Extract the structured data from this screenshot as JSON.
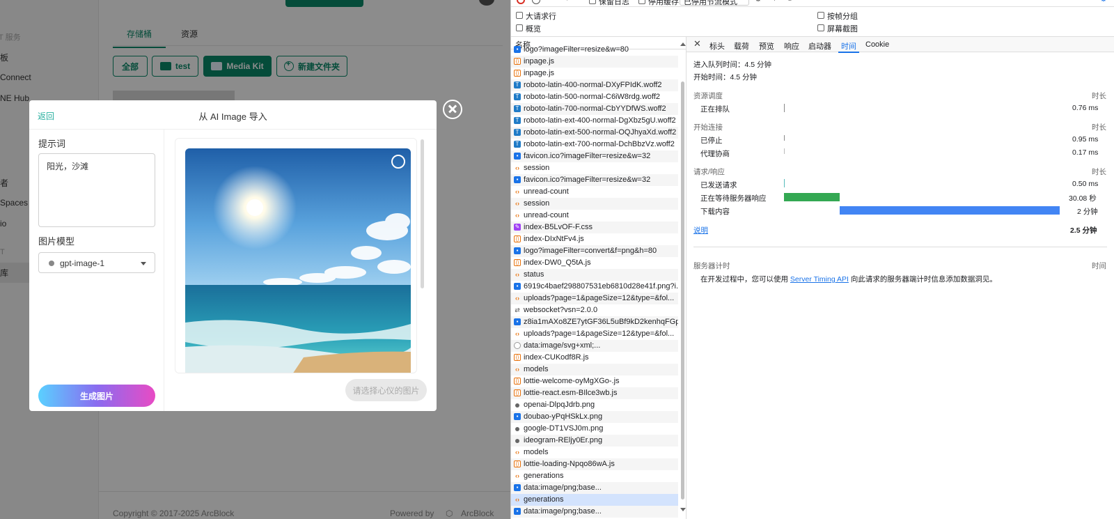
{
  "app": {
    "sidebar_items": [
      "T 服务",
      "板",
      "Connect",
      "NE Hub",
      "者",
      "Spaces",
      "io",
      "T",
      "库"
    ],
    "tabs": [
      "存储桶",
      "资源"
    ],
    "buttons": [
      "全部",
      "test",
      "Media Kit",
      "新建文件夹"
    ],
    "footer_copyright": "Copyright © 2017-2025  ArcBlock",
    "footer_powered": "Powered by",
    "footer_brand": "ArcBlock"
  },
  "modal": {
    "back": "返回",
    "title": "从 AI Image 导入",
    "prompt_label": "提示词",
    "prompt_value": "阳光，沙滩",
    "model_label": "图片模型",
    "model_value": "gpt-image-1",
    "generate_button": "生成图片",
    "confirm_button": "请选择心仪的图片"
  },
  "devtools": {
    "options": [
      "保留日志",
      "停用缓存",
      "已停用节流模式",
      "大请求行",
      "概览",
      "按帧分组",
      "屏幕截图"
    ],
    "name_header": "名称",
    "requests": [
      {
        "name": "logo?imageFilter=resize&w=80",
        "type": "img"
      },
      {
        "name": "inpage.js",
        "type": "js"
      },
      {
        "name": "inpage.js",
        "type": "js"
      },
      {
        "name": "roboto-latin-400-normal-DXyFPIdK.woff2",
        "type": "font"
      },
      {
        "name": "roboto-latin-500-normal-C6iW8rdg.woff2",
        "type": "font"
      },
      {
        "name": "roboto-latin-700-normal-CbYYDfWS.woff2",
        "type": "font"
      },
      {
        "name": "roboto-latin-ext-400-normal-DgXbz5gU.woff2",
        "type": "font"
      },
      {
        "name": "roboto-latin-ext-500-normal-OQJhyaXd.woff2",
        "type": "font"
      },
      {
        "name": "roboto-latin-ext-700-normal-DchBbzVz.woff2",
        "type": "font"
      },
      {
        "name": "favicon.ico?imageFilter=resize&w=32",
        "type": "img"
      },
      {
        "name": "session",
        "type": "fetch"
      },
      {
        "name": "favicon.ico?imageFilter=resize&w=32",
        "type": "img"
      },
      {
        "name": "unread-count",
        "type": "fetch"
      },
      {
        "name": "session",
        "type": "fetch"
      },
      {
        "name": "unread-count",
        "type": "fetch"
      },
      {
        "name": "index-B5LvOF-F.css",
        "type": "css"
      },
      {
        "name": "index-DIxNtFv4.js",
        "type": "js"
      },
      {
        "name": "logo?imageFilter=convert&f=png&h=80",
        "type": "img"
      },
      {
        "name": "index-DW0_Q5tA.js",
        "type": "js"
      },
      {
        "name": "status",
        "type": "fetch"
      },
      {
        "name": "6919c4baef298807531eb6810d28e41f.png?i...",
        "type": "img"
      },
      {
        "name": "uploads?page=1&pageSize=12&type=&fol...",
        "type": "fetch"
      },
      {
        "name": "websocket?vsn=2.0.0",
        "type": "ws"
      },
      {
        "name": "z8ia1mAXo8ZE7ytGF36L5uBf9kD2kenhqFGp9",
        "type": "img"
      },
      {
        "name": "uploads?page=1&pageSize=12&type=&fol...",
        "type": "fetch"
      },
      {
        "name": "data:image/svg+xml;...",
        "type": "svg"
      },
      {
        "name": "index-CUKodf8R.js",
        "type": "js"
      },
      {
        "name": "models",
        "type": "fetch"
      },
      {
        "name": "lottie-welcome-oyMgXGo-.js",
        "type": "js"
      },
      {
        "name": "lottie-react.esm-BIlce3wb.js",
        "type": "js"
      },
      {
        "name": "openai-DlpqJdrb.png",
        "type": "dot"
      },
      {
        "name": "doubao-yPqHSkLx.png",
        "type": "img"
      },
      {
        "name": "google-DT1VSJ0m.png",
        "type": "dot"
      },
      {
        "name": "ideogram-REljy0Er.png",
        "type": "dot"
      },
      {
        "name": "models",
        "type": "fetch"
      },
      {
        "name": "lottie-loading-Npqo86wA.js",
        "type": "js"
      },
      {
        "name": "generations",
        "type": "fetch"
      },
      {
        "name": "data:image/png;base...",
        "type": "img"
      },
      {
        "name": "generations",
        "type": "fetch",
        "selected": true
      },
      {
        "name": "data:image/png;base...",
        "type": "img"
      }
    ],
    "detail_tabs": [
      "标头",
      "载荷",
      "预览",
      "响应",
      "启动器",
      "时间",
      "Cookie"
    ],
    "active_tab": "时间",
    "timing": {
      "queued_at": "进入队列时间：4.5 分钟",
      "started_at": "开始时间：4.5 分钟",
      "duration_header": "时长",
      "sections": [
        {
          "title": "资源调度",
          "rows": [
            {
              "label": "正在排队",
              "value": "0.76 ms"
            }
          ]
        },
        {
          "title": "开始连接",
          "rows": [
            {
              "label": "已停止",
              "value": "0.95 ms"
            },
            {
              "label": "代理协商",
              "value": "0.17 ms"
            }
          ]
        },
        {
          "title": "请求/响应",
          "rows": [
            {
              "label": "已发送请求",
              "value": "0.50 ms"
            },
            {
              "label": "正在等待服务器响应",
              "value": "30.08 秒"
            },
            {
              "label": "下载内容",
              "value": "2 分钟"
            }
          ]
        }
      ],
      "explain_link": "说明",
      "total": "2.5 分钟",
      "server_timing_title": "服务器计时",
      "server_timing_col": "时间",
      "server_timing_text_pre": "在开发过程中，您可以使用",
      "server_timing_link": "Server Timing API",
      "server_timing_text_post": "向此请求的服务器端计时信息添加数据洞见。"
    },
    "colors": {
      "waiting": "#34a853",
      "download": "#4285f4",
      "accent": "#1a73e8"
    }
  }
}
